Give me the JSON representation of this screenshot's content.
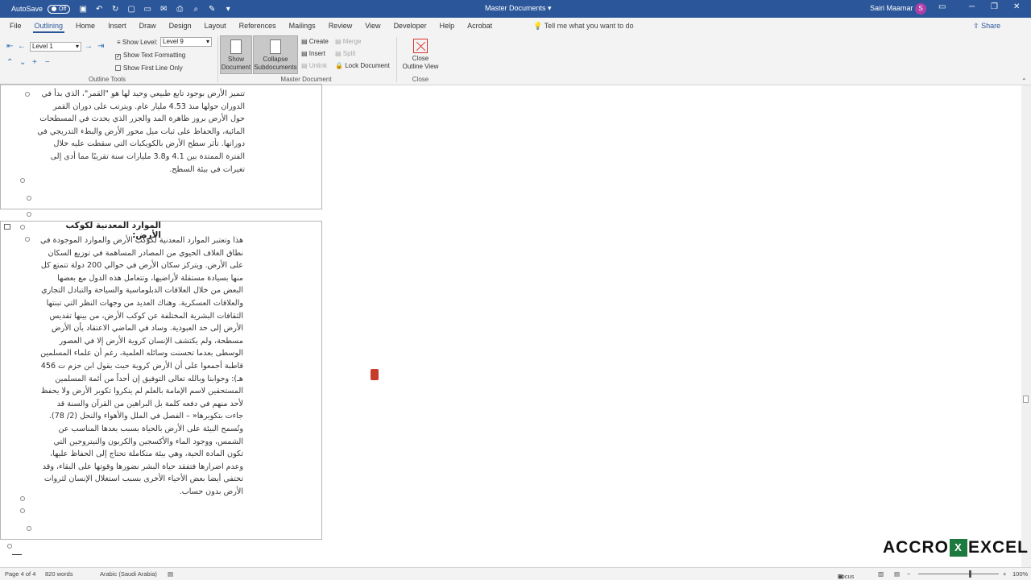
{
  "titlebar": {
    "autosave_label": "AutoSave",
    "autosave_state": "Off",
    "doc_title": "Master Documents",
    "doc_title_caret": "▾",
    "user_name": "Sairi Maamar",
    "avatar_initial": "S"
  },
  "menu": {
    "tabs": [
      "File",
      "Outlining",
      "Home",
      "Insert",
      "Draw",
      "Design",
      "Layout",
      "References",
      "Mailings",
      "Review",
      "View",
      "Developer",
      "Help",
      "Acrobat"
    ],
    "active_tab": "Outlining",
    "tell_me": "Tell me what you want to do",
    "share": "Share"
  },
  "ribbon": {
    "outline_tools": {
      "level_value": "Level 1",
      "show_level_label": "Show Level:",
      "show_level_value": "Level 9",
      "show_text_formatting": "Show Text Formatting",
      "show_first_line_only": "Show First Line Only",
      "group_label": "Outline Tools"
    },
    "master_document": {
      "show_document": "Show Document",
      "collapse_subdocuments": "Collapse Subdocuments",
      "create": "Create",
      "insert": "Insert",
      "unlink": "Unlink",
      "merge": "Merge",
      "split": "Split",
      "lock_document": "Lock Document",
      "group_label": "Master Document"
    },
    "close": {
      "close_outline_view": "Close Outline View",
      "group_label": "Close"
    }
  },
  "document": {
    "para1": "تتميز الأرض بوجود تابع طبيعي وحيد لها هو \"القمر\"، الذي بدأ في الدوران حولها منذ 4.53 مليار عام. ويترتب على دوران القمر حول الأرض بروز ظاهرة المد والجزر الذي يحدث في المسطحات المائية، والحفاظ على ثبات ميل محور الأرض والبطء التدريجي في دورانها. تأثر سطح الأرض بالكويكبات التي سقطت عليه خلال الفترة الممتدة بين 4.1 و3.8 مليارات سنة تقريبًا مما أدى إلى تغيرات في بيئة السطح.",
    "heading2": "الموارد المعدنية لكوكب الأرض:",
    "para2": "هذا وتعتبر الموارد المعدنية لكوكب الأرض والموارد الموجودة في نطاق الغلاف الحيوي من المصادر المساهمة في توزيع السكان على الأرض. ويتركز سكان الأرض في حوالي 200 دولة تتمتع كل منها بسيادة مستقلة لأراضيها، وتتعامل هذه الدول مع بعضها البعض من خلال العلاقات الدبلوماسية والسياحة والتبادل التجاري والعلاقات العسكرية. وهناك العديد من وجهات النظر التي تبنتها الثقافات البشرية المختلفة عن كوكب الأرض، من بينها تقديس الأرض إلى حد العبودية. وساد في الماضي الاعتقاد بأن الأرض مسطحة، ولم يكتشف الإنسان كروية الأرض إلا في العصور الوسطى بعدما تحسنت وسائله العلمية، رغم أن علماء المسلمين قاطبة أجمعوا على أن الأرض كروية حيث يقول ابن حزم ت 456 هـ): وجوابنا وبالله تعالى التوفيق إن أحداً من أئمة المسلمين المستحقين لاسم الإمامة بالعلم لم ينكروا تكوير الأرض ولا يحفظ لأحد منهم في دفعه كلمة بل البراهين من القرآن والسنة قد جاءت بتكويرها« – الفصل في الملل والأهواء والنحل (2/ 78). وتُسمح البيئة على الأرض بالحياة بسبب بعدها المناسب عن الشمس، ووجود الماء والأكسجين والكربون والنيتروجين التي تكون المادة الحية، وهي بيئة متكاملة تحتاج إلى الحفاظ عليها، وعدم اضرارها فتفقد حياة البشر نضورها وقوتها على البقاء، وقد تختفي أيضا بعض الأحياء الأخرى بسبب استغلال الإنسان لثروات الأرض بدون حساب."
  },
  "statusbar": {
    "page": "Page 4 of 4",
    "words": "820 words",
    "language": "Arabic (Saudi Arabia)",
    "focus": "Focus",
    "zoom": "100%"
  },
  "watermark": {
    "left": "ACCRO",
    "x": "X",
    "right": "EXCEL"
  },
  "colors": {
    "titlebar": "#2b579a",
    "avatar": "#b13fa8"
  }
}
